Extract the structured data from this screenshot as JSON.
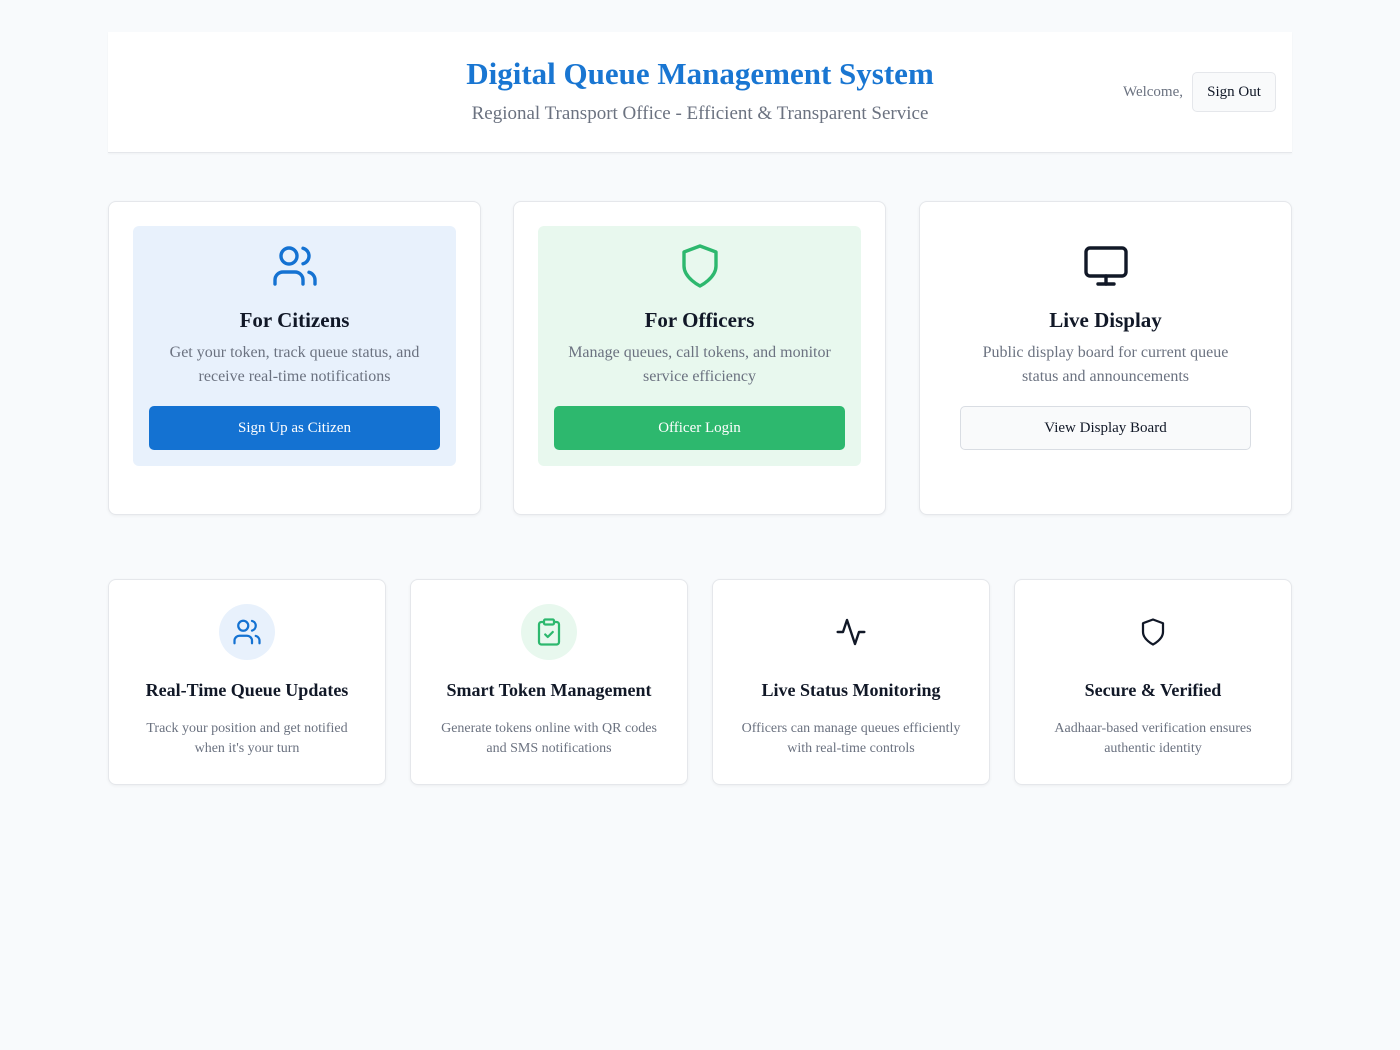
{
  "header": {
    "title": "Digital Queue Management System",
    "subtitle": "Regional Transport Office - Efficient & Transparent Service",
    "welcome_text": "Welcome,",
    "signout_label": "Sign Out"
  },
  "roles": [
    {
      "icon": "users-icon",
      "title": "For Citizens",
      "description": "Get your token, track queue status, and receive real-time notifications",
      "button_label": "Sign Up as Citizen",
      "accent": "#1472d2"
    },
    {
      "icon": "shield-icon",
      "title": "For Officers",
      "description": "Manage queues, call tokens, and monitor service efficiency",
      "button_label": "Officer Login",
      "accent": "#2db86e"
    },
    {
      "icon": "monitor-icon",
      "title": "Live Display",
      "description": "Public display board for current queue status and announcements",
      "button_label": "View Display Board",
      "accent": "#111827"
    }
  ],
  "features": [
    {
      "icon": "users-icon",
      "title": "Real-Time Queue Updates",
      "description": "Track your position and get notified when it's your turn"
    },
    {
      "icon": "clipboard-check-icon",
      "title": "Smart Token Management",
      "description": "Generate tokens online with QR codes and SMS notifications"
    },
    {
      "icon": "activity-icon",
      "title": "Live Status Monitoring",
      "description": "Officers can manage queues efficiently with real-time controls"
    },
    {
      "icon": "shield-icon",
      "title": "Secure & Verified",
      "description": "Aadhaar-based verification ensures authentic identity"
    }
  ]
}
